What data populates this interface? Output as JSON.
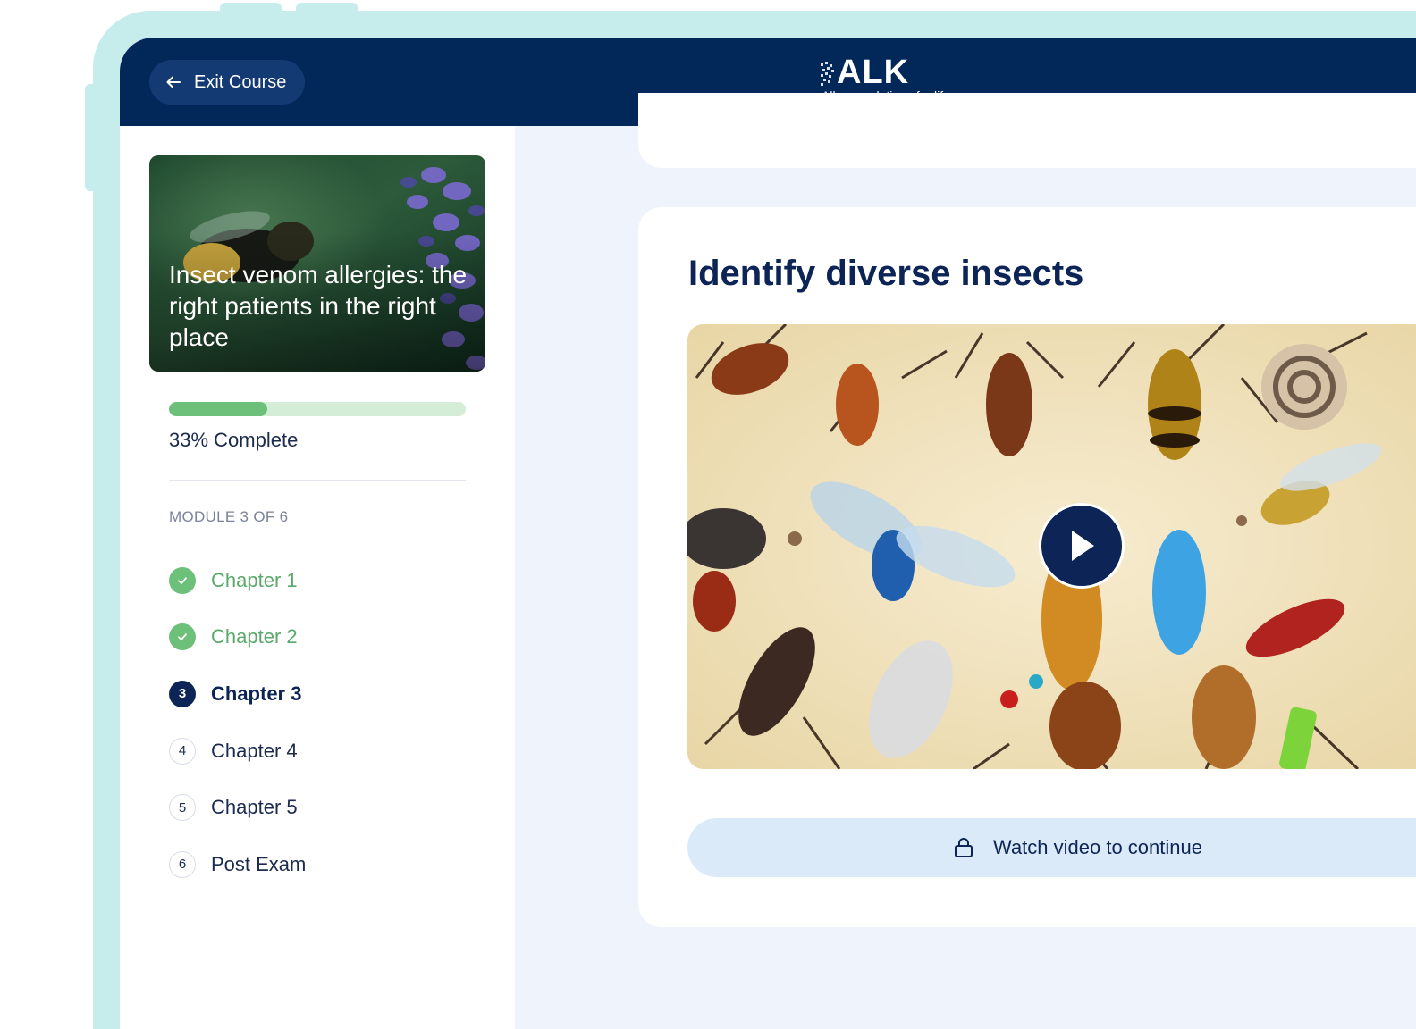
{
  "header": {
    "exit_label": "Exit Course",
    "logo_text": "ALK",
    "logo_tagline": "Allergy solutions for life"
  },
  "sidebar": {
    "course_title": "Insect venom allergies: the right patients in the right place",
    "progress": {
      "percent": 33,
      "label": "33% Complete",
      "fill_color": "#6cc07a",
      "track_color": "#d3edd7"
    },
    "module_label": "MODULE 3 OF 6",
    "chapters": [
      {
        "badge": "",
        "label": "Chapter 1",
        "state": "done",
        "icon": "check-icon"
      },
      {
        "badge": "",
        "label": "Chapter 2",
        "state": "done",
        "icon": "check-icon"
      },
      {
        "badge": "3",
        "label": "Chapter 3",
        "state": "current"
      },
      {
        "badge": "4",
        "label": "Chapter 4",
        "state": "todo"
      },
      {
        "badge": "5",
        "label": "Chapter 5",
        "state": "todo"
      },
      {
        "badge": "6",
        "label": "Post Exam",
        "state": "todo"
      }
    ]
  },
  "main": {
    "title": "Identify diverse insects",
    "video": {
      "icon": "play-icon"
    },
    "watch_label": "Watch video to continue",
    "watch_icon": "lock-icon"
  },
  "colors": {
    "navy": "#022759",
    "accent_green": "#6cc07a",
    "frame": "#c6ecec"
  }
}
